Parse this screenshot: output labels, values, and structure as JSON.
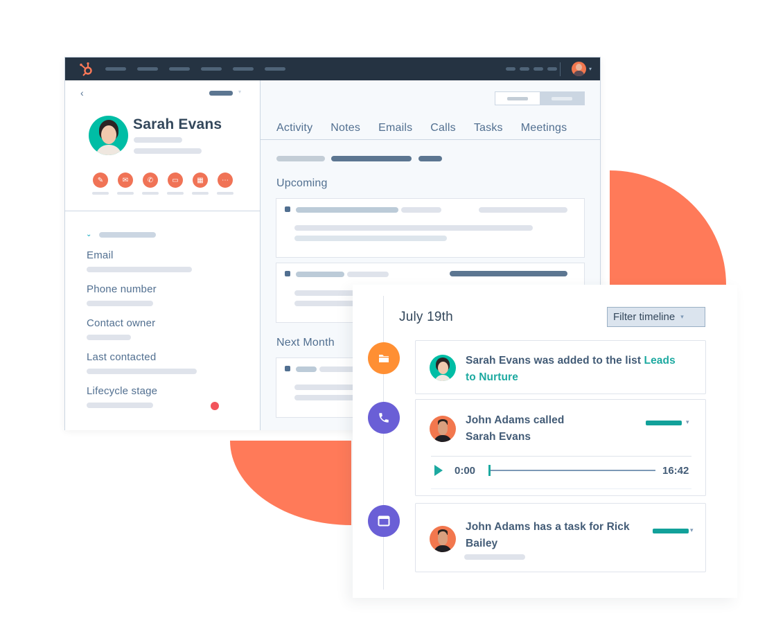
{
  "colors": {
    "coral": "#ff7a59",
    "nav_bg": "#253342",
    "teal": "#1ca9a0",
    "orange_icon": "#ff8f33",
    "purple_icon": "#6a5fd6",
    "action_icon": "#f07356"
  },
  "topnav": {
    "logo": "hubspot-sprocket-icon",
    "nav_item_count": 6,
    "user_menu_caret": "▾"
  },
  "profile": {
    "back": "‹",
    "actions_caret": "▾",
    "name": "Sarah Evans",
    "actions": [
      {
        "name": "note",
        "icon": "✎"
      },
      {
        "name": "email",
        "icon": "✉"
      },
      {
        "name": "call",
        "icon": "✆"
      },
      {
        "name": "task",
        "icon": "▭"
      },
      {
        "name": "meeting",
        "icon": "▦"
      },
      {
        "name": "more",
        "icon": "⋯"
      }
    ],
    "about_toggle": "⌄",
    "properties": [
      {
        "label": "Email"
      },
      {
        "label": "Phone number"
      },
      {
        "label": "Contact owner"
      },
      {
        "label": "Last contacted"
      },
      {
        "label": "Lifecycle stage"
      }
    ]
  },
  "activity": {
    "tabs": [
      "Activity",
      "Notes",
      "Emails",
      "Calls",
      "Tasks",
      "Meetings"
    ],
    "sections": {
      "upcoming": "Upcoming",
      "next_month": "Next Month"
    }
  },
  "timeline": {
    "date": "July 19th",
    "filter_button": "Filter timeline",
    "filter_caret": "▾",
    "events": [
      {
        "type": "list",
        "icon": "folder-icon",
        "text": "Sarah Evans was added to the list ",
        "link": "Leads to Nurture"
      },
      {
        "type": "call",
        "icon": "phone-icon",
        "line1": "John Adams called",
        "line2": "Sarah Evans",
        "status_caret": "▾",
        "audio": {
          "current_time": "0:00",
          "duration": "16:42",
          "progress": 0
        }
      },
      {
        "type": "task",
        "icon": "task-icon",
        "line1": "John Adams has a task for Rick",
        "line2": "Bailey",
        "status_caret": "▾"
      }
    ]
  }
}
